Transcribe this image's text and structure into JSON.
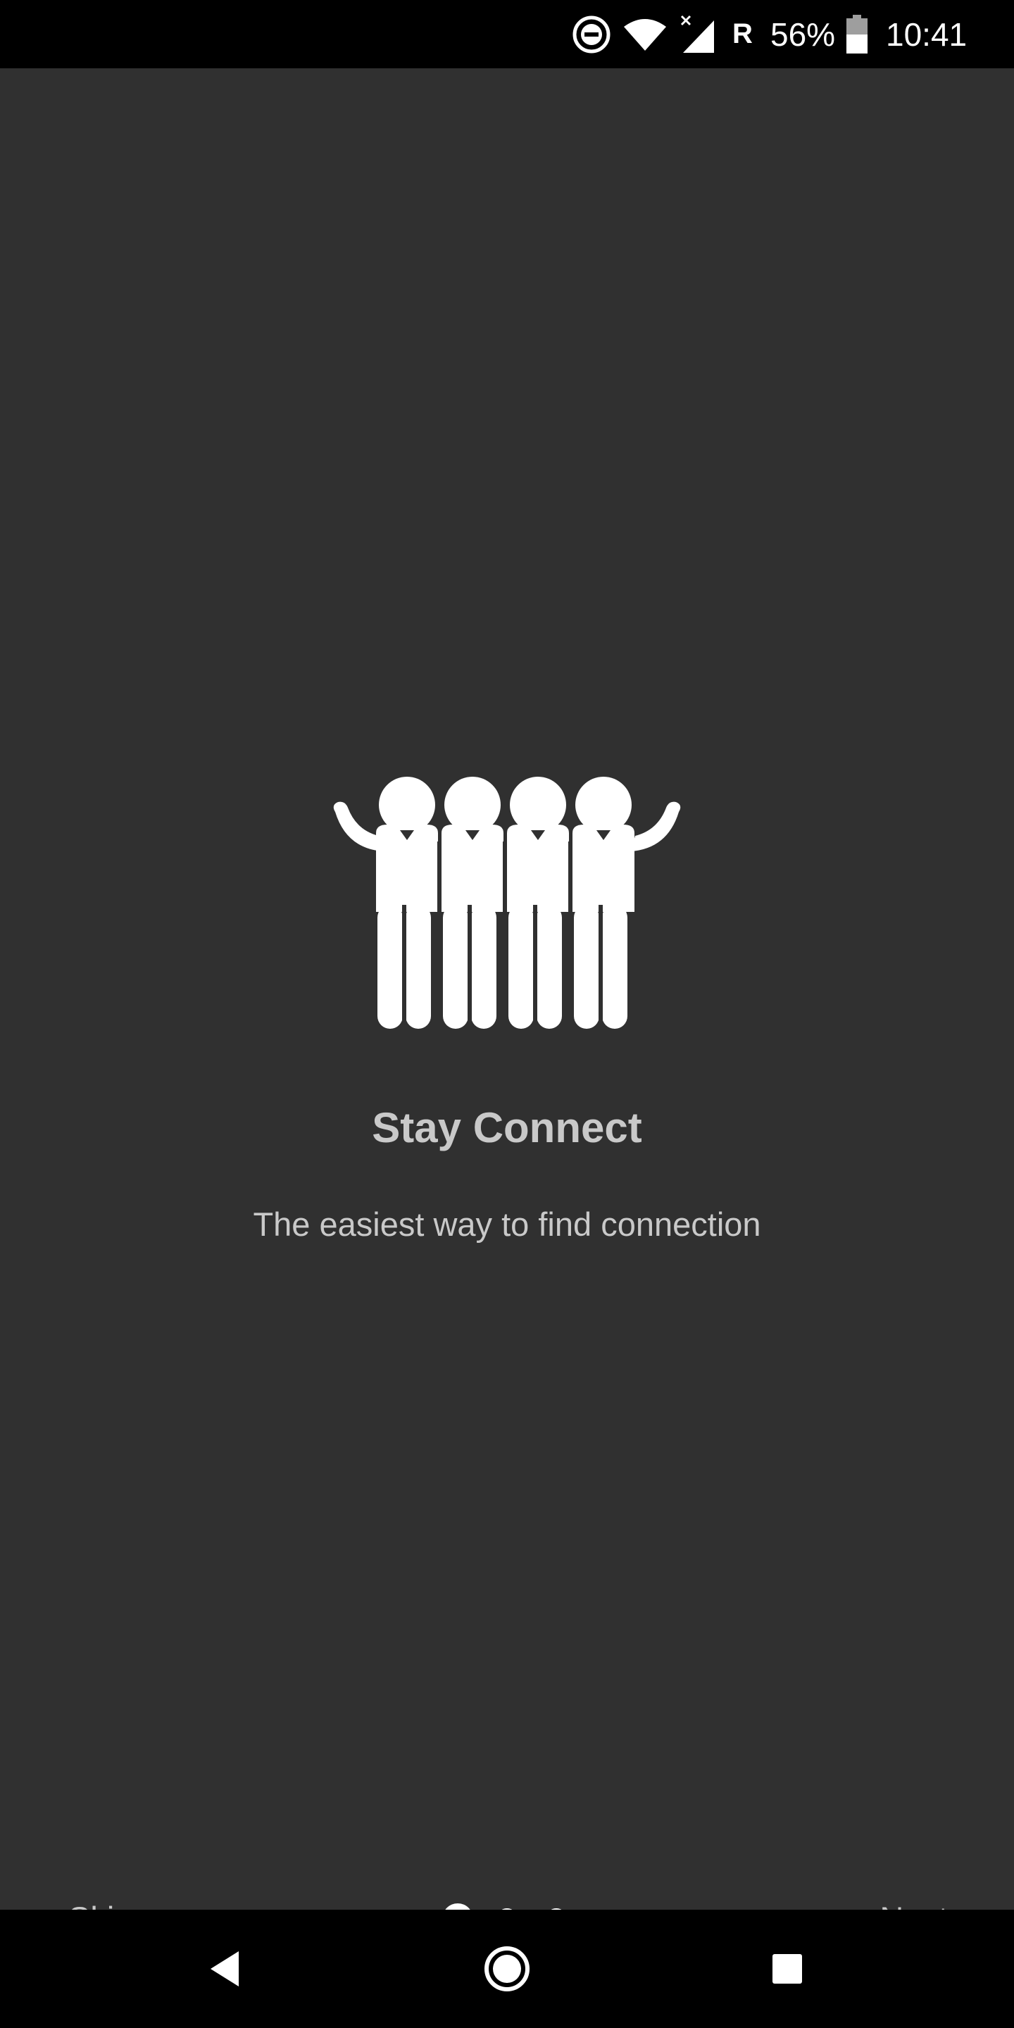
{
  "status_bar": {
    "network_type": "R",
    "battery_percent": "56%",
    "time": "10:41",
    "icons": [
      "do-not-disturb-icon",
      "wifi-icon",
      "cell-signal-icon",
      "battery-icon"
    ]
  },
  "onboarding": {
    "illustration": "group-of-people-icon",
    "title": "Stay Connect",
    "subtitle": "The easiest way to find connection",
    "skip_label": "Skip",
    "next_label": "Next",
    "page_indicator": {
      "total": 3,
      "current": 1
    }
  },
  "nav_bar": {
    "icons": [
      "back-icon",
      "home-icon",
      "recents-icon"
    ]
  },
  "colors": {
    "background": "#303030",
    "text": "#c9c9c9",
    "bars": "#000000",
    "icon": "#ffffff"
  }
}
